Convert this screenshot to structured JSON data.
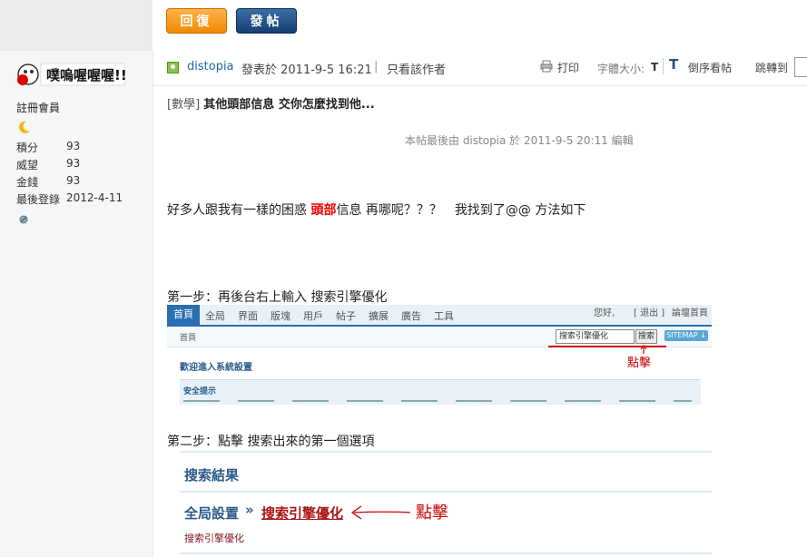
{
  "actions": {
    "reply_label": "回復",
    "post_label": "發帖"
  },
  "user": {
    "avatar_text": "噗嗚喔喔喔!!",
    "rank": "註冊會員",
    "stats": [
      {
        "label": "積分",
        "value": "93"
      },
      {
        "label": "威望",
        "value": "93"
      },
      {
        "label": "金錢",
        "value": "93"
      },
      {
        "label": "最後登錄",
        "value": "2012-4-11"
      }
    ]
  },
  "post_header": {
    "author": "distopia",
    "posted_at": "發表於 2011-9-5 16:21",
    "separator": "|",
    "only_author": "只看該作者",
    "print": "打印",
    "font_size_label": "字體大小:",
    "font_t": "T",
    "big_t": "T",
    "reverse": "倒序看帖",
    "jump": "跳轉到"
  },
  "post": {
    "category": "[數學]",
    "title": "其他頭部信息 交你怎麼找到他...",
    "edited": "本帖最後由 distopia 於 2011-9-5 20:11 編輯",
    "para_before": "好多人跟我有一樣的困惑 ",
    "para_highlight": "頭部",
    "para_after": "信息 再哪呢？？？　我找到了@@ 方法如下",
    "step1": "第一步：再後台右上輸入 搜索引擎優化",
    "step2": "第二步：點擊 搜索出來的第一個選項"
  },
  "shot1": {
    "tabs": [
      "首頁",
      "全局",
      "界面",
      "版塊",
      "用戶",
      "帖子",
      "擴展",
      "廣告",
      "工具"
    ],
    "user_text": "您好,",
    "logout": "[ 退出 ]",
    "forum_home": "論壇首頁",
    "home": "首頁",
    "search_value": "搜索引擎優化",
    "search_button": "搜索",
    "sitemap": "SITEMAP ↓",
    "click": "點擊",
    "welcome": "歡迎進入系統設置",
    "tip": "安全提示"
  },
  "shot2": {
    "results": "搜索結果",
    "crumb": "全局設置",
    "sep": "»",
    "seo": "搜索引擎優化",
    "click": "點擊",
    "sub": "搜索引擎優化"
  },
  "colors": {
    "accent": "#2a6fb1",
    "highlight": "#e00000",
    "reply": "#f08a00",
    "post": "#163e72"
  }
}
